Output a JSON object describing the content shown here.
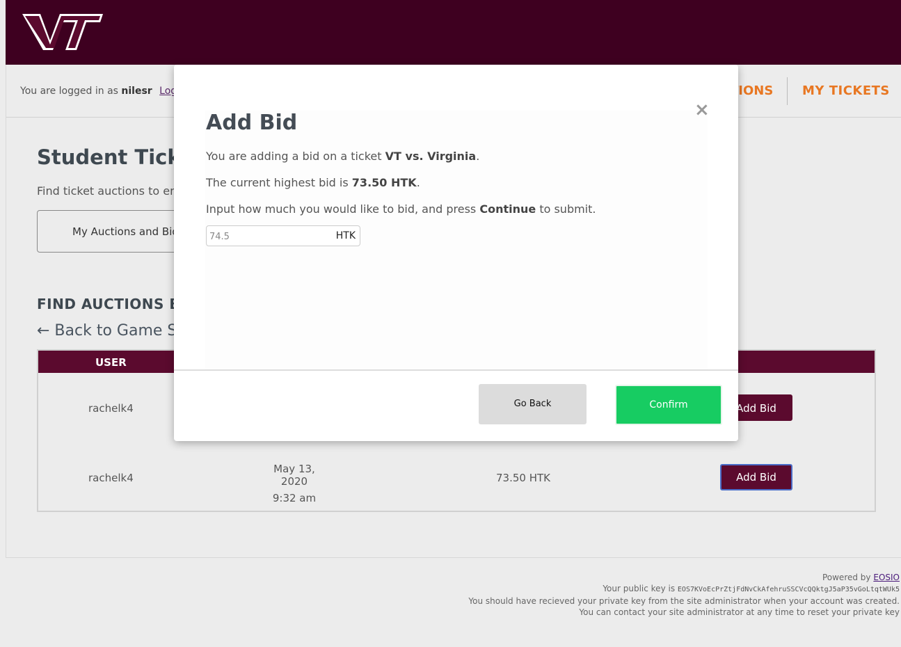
{
  "header": {
    "logo_alt": "VT"
  },
  "userbar": {
    "logged_prefix": "You are logged in as",
    "username": "nilesr",
    "logout": "Logout",
    "nav_auctions": "TIONS",
    "nav_tickets": "MY TICKETS"
  },
  "main": {
    "heading": "Student Ticket",
    "subtext": "Find ticket auctions to ente",
    "tab_label": "My Auctions and Bids",
    "find_heading": "FIND AUCTIONS BY",
    "back_link": "← Back to Game Se"
  },
  "table": {
    "header_user": "USER",
    "rows": [
      {
        "user": "rachelk4",
        "date": "",
        "time": "",
        "bid": "",
        "action": "Add Bid"
      },
      {
        "user": "rachelk4",
        "date": "May 13, 2020",
        "time": "9:32 am",
        "bid": "73.50 HTK",
        "action": "Add Bid"
      }
    ]
  },
  "footer": {
    "powered_by": "Powered by",
    "eosio": "EOSIO",
    "pubkey_label": "Your public key is",
    "pubkey": "EOS7KVoEcPrZtjFdNvCkAfehruSSCVcQQktgJ5aP35vGoLtqtWUk5",
    "line2": "You should have recieved your private key from the site administrator when your account was created.",
    "line3": "You can contact your site administrator at any time to reset your private key"
  },
  "modal": {
    "title": "Add Bid",
    "close": "×",
    "line1_prefix": "You are adding a bid on a ticket",
    "line1_game": "VT vs. Virginia",
    "line2_prefix": "The current highest bid is",
    "line2_amount": "73.50 HTK",
    "line3_prefix": "Input how much you would like to bid, and press",
    "line3_action": "Continue",
    "line3_suffix": "to submit.",
    "bid_value": "74.5",
    "bid_unit": "HTK",
    "go_back": "Go Back",
    "confirm": "Confirm"
  },
  "colors": {
    "maroon": "#3e0020",
    "orange": "#e87722",
    "green": "#17cc62"
  }
}
